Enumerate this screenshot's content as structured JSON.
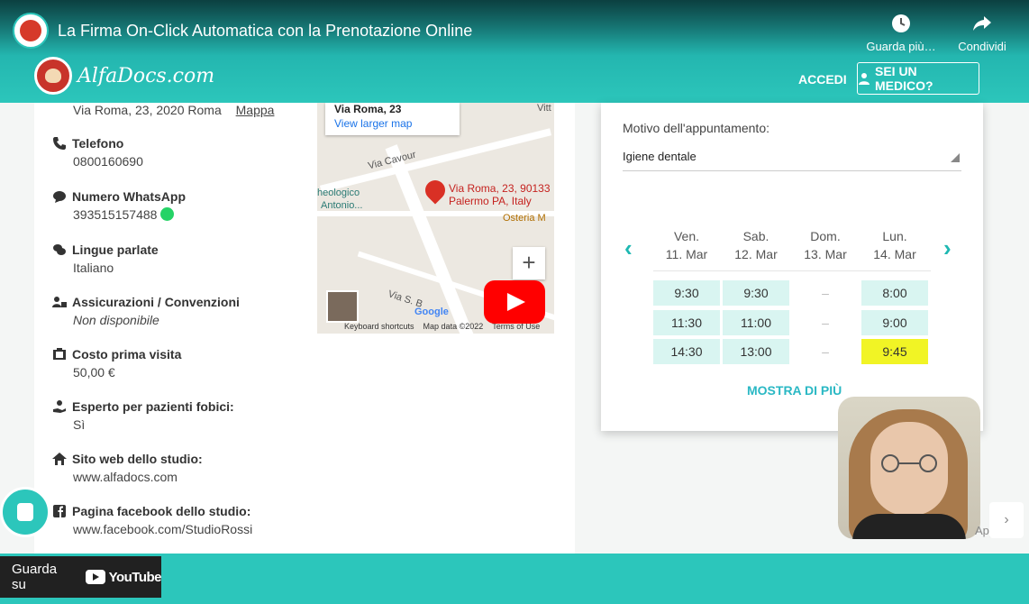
{
  "video": {
    "title": "La Firma On-Click Automatica con la Prenotazione Online",
    "actions": [
      {
        "label": "Guarda più…",
        "icon": "clock-icon"
      },
      {
        "label": "Condividi",
        "icon": "share-icon"
      }
    ],
    "watch_on": "Guarda su",
    "youtube_label": "YouTube"
  },
  "site": {
    "brand": "AlfaDocs.com",
    "nav": {
      "login": "ACCEDI",
      "doctor": "SEI UN MEDICO?"
    }
  },
  "info": {
    "address": "Via Roma, 23, 2020 Roma",
    "map_link": "Mappa",
    "items": [
      {
        "label": "Telefono",
        "value": "0800160690",
        "icon": "phone-icon"
      },
      {
        "label": "Numero WhatsApp",
        "value": "393515157488",
        "icon": "chat-bubble-icon"
      },
      {
        "label": "Lingue parlate",
        "value": "Italiano",
        "icon": "speech-icon"
      },
      {
        "label": "Assicurazioni / Convenzioni",
        "value": "Non disponibile",
        "icon": "insurance-icon"
      },
      {
        "label": "Costo prima visita",
        "value": "50,00 €",
        "icon": "cash-icon"
      },
      {
        "label": "Esperto per pazienti fobici:",
        "value": "Sì",
        "icon": "care-hand-icon"
      },
      {
        "label": "Sito web dello studio:",
        "value": "www.alfadocs.com",
        "icon": "home-icon"
      },
      {
        "label": "Pagina facebook dello studio:",
        "value": "www.facebook.com/StudioRossi",
        "icon": "facebook-icon"
      }
    ]
  },
  "map": {
    "card_title": "Via Roma, 23",
    "card_link": "View larger map",
    "pin_label_1": "Via Roma, 23, 90133",
    "pin_label_2": "Palermo PA, Italy",
    "place_1": "Via Cavour",
    "place_2": "heologico",
    "place_3": "Antonio...",
    "place_4": "Osteria M",
    "place_5": "Via S. B",
    "place_6": "Vitt",
    "footer": [
      "Keyboard shortcuts",
      "Map data ©2022",
      "Terms of Use"
    ],
    "google": "Google"
  },
  "booking": {
    "reason_label": "Motivo dell'appuntamento:",
    "reason_value": "Igiene dentale",
    "days": [
      {
        "name": "Ven.",
        "date": "11. Mar",
        "slots": [
          "9:30",
          "11:30",
          "14:30"
        ]
      },
      {
        "name": "Sab.",
        "date": "12. Mar",
        "slots": [
          "9:30",
          "11:00",
          "13:00"
        ]
      },
      {
        "name": "Dom.",
        "date": "13. Mar",
        "slots": [
          "–",
          "–",
          "–"
        ]
      },
      {
        "name": "Lun.",
        "date": "14. Mar",
        "slots": [
          "8:00",
          "9:00",
          "9:45"
        ]
      }
    ],
    "show_more": "MOSTRA DI PIÙ"
  },
  "overlay": {
    "app_text": "App"
  },
  "colors": {
    "teal": "#2cc6bb",
    "highlight": "#f1f425",
    "slot_bg": "#d9f5f1",
    "play": "#ff0000"
  }
}
